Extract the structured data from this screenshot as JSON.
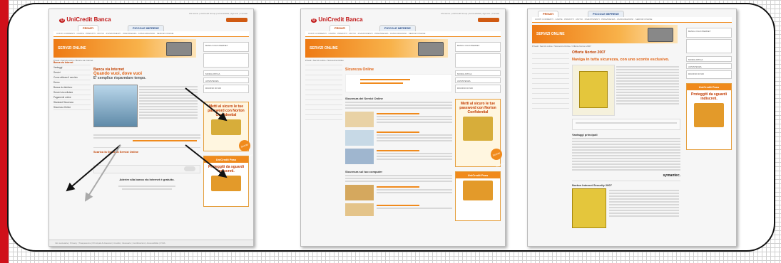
{
  "brand": {
    "name": "UniCredit Banca",
    "accent": "#d0101a",
    "orange": "#f08a1c"
  },
  "util_links": "Chi siamo | UniCredit Group | Accessibilità | Agenzie | Contatti",
  "tabs": {
    "private": "PRIVATI",
    "business": "PICCOLE IMPRESE"
  },
  "nav_text": "CONTI CORRENTI · CARTE · PRESTITI · MUTUI · INVESTIMENTI · PREVIDENZA · ASSICURAZIONI · SERVIZI ONLINE",
  "banner": "SERVIZI ONLINE",
  "screens": [
    {
      "breadcrumb": "Privati / Servizi online / Banca via Internet",
      "side_items": [
        "Banca via Internet",
        "Vantaggi",
        "Servizi",
        "Come attivare il servizio",
        "Demo",
        "Banca via telefono",
        "Servizi via cellulare",
        "Pagamenti online",
        "Standard Sicurezza",
        "Sicurezza Online"
      ],
      "title": "Banca via Internet",
      "headline": "Quando vuoi, dove vuoi",
      "subhead": "E' semplice risparmiare tempo.",
      "guide_link": "Scarica la Guida ai Servizi Online",
      "footer_line": "Aderire alla banca via Internet è gratuito.",
      "promo": "Metti al sicuro le tue password con Norton Confidential",
      "promo2": "Proteggiti da sguardi indiscreti.",
      "badge": "Sconto del 40%"
    },
    {
      "breadcrumb": "Privati / Servizi online / Sicurezza Online",
      "title": "Sicurezza Online",
      "section1": "Sicurezza dei Servizi Online",
      "section2": "Sicurezza sul tuo computer",
      "promo": "Metti al sicuro le tue password con Norton Confidential",
      "badge": "Sconto del 40%"
    },
    {
      "breadcrumb": "Privati / Servizi online / Sicurezza Online / Offerte Norton 2007",
      "title": "Offerte Norton 2007",
      "headline": "Naviga in tutta sicurezza, con uno sconto esclusivo.",
      "section1": "Vantaggi principali",
      "section2": "Norton Internet Security 2007",
      "promo": "Proteggiti da sguardi indiscreti.",
      "vendor": "symantec."
    }
  ],
  "footer": "Info societarie | Privacy | Trasparenza | Principali & Adesioni | Credits | Glossario | Certificazioni | Accessibilità | P.IVA"
}
